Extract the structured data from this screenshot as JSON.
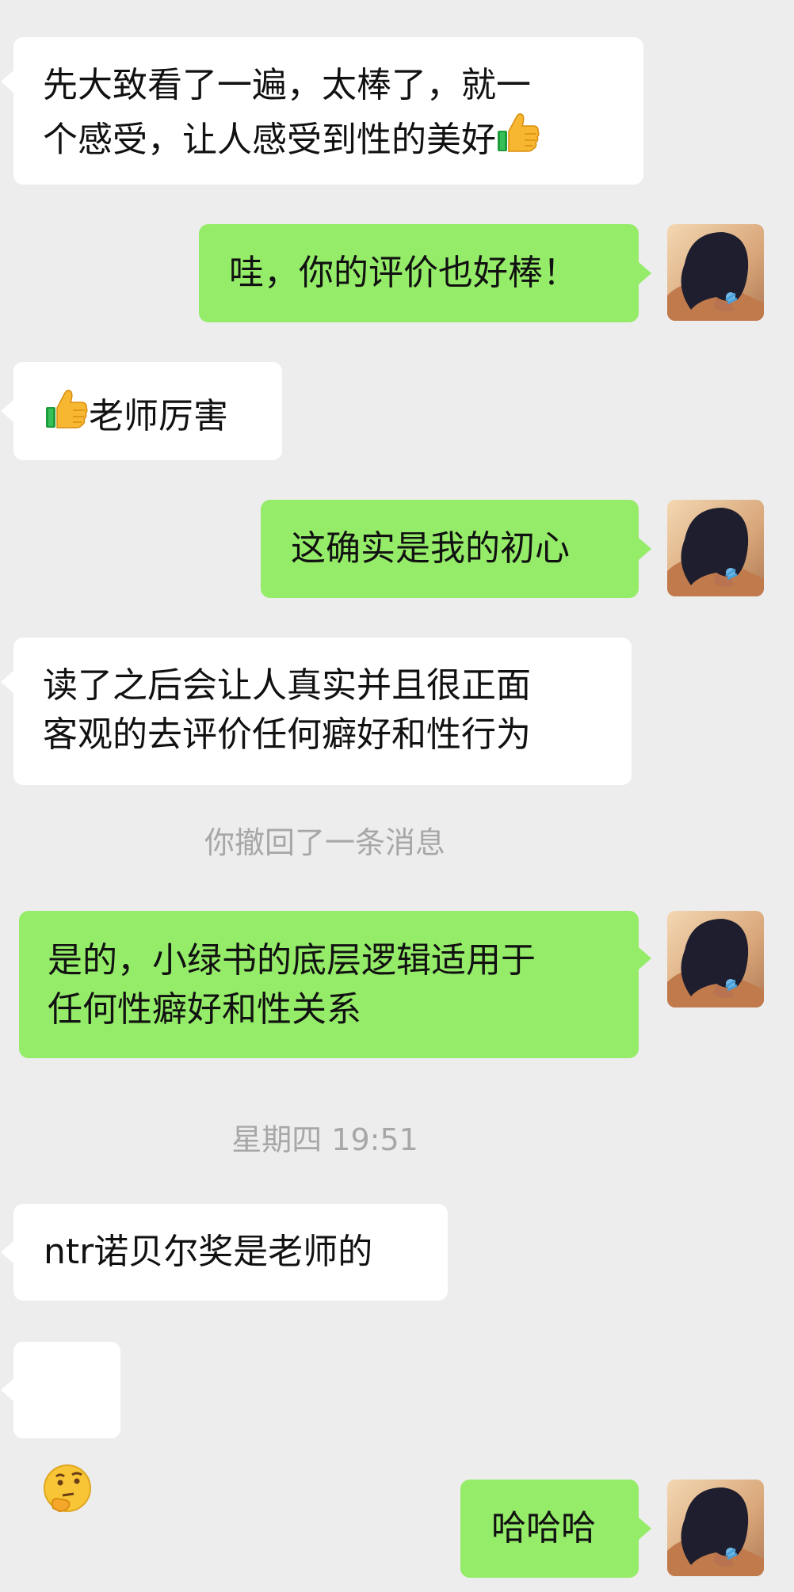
{
  "chat": {
    "messages": [
      {
        "side": "left",
        "lines": [
          "先大致看了一遍，太棒了，就一",
          "个感受，让人感受到性的美好"
        ],
        "trailing_icon": "thumbs-up-emoji"
      },
      {
        "side": "right",
        "text": "哇，你的评价也好棒！"
      },
      {
        "side": "left",
        "leading_icon": "thumbs-up-emoji",
        "text": "老师厉害"
      },
      {
        "side": "right",
        "text": "这确实是我的初心"
      },
      {
        "side": "left",
        "lines": [
          "读了之后会让人真实并且很正面",
          "客观的去评价任何癖好和性行为"
        ]
      },
      {
        "side": "right",
        "lines": [
          "是的，小绿书的底层逻辑适用于",
          "任何性癖好和性关系"
        ]
      },
      {
        "side": "left",
        "text": "ntr诺贝尔奖是老师的"
      },
      {
        "side": "left",
        "icon": "thinking-face-emoji"
      },
      {
        "side": "right",
        "text": "哈哈哈"
      }
    ],
    "system": {
      "recall_notice": "你撤回了一条消息",
      "timestamp": "星期四 19:51"
    }
  },
  "colors": {
    "background": "#ededed",
    "incoming_bubble": "#ffffff",
    "outgoing_bubble": "#95ec69",
    "text": "#111111",
    "system_text": "#a7a7a7"
  },
  "icons": {
    "avatar": "avatar-photo",
    "thumbs_up": "thumbs-up-emoji",
    "thinking": "thinking-face-emoji"
  }
}
